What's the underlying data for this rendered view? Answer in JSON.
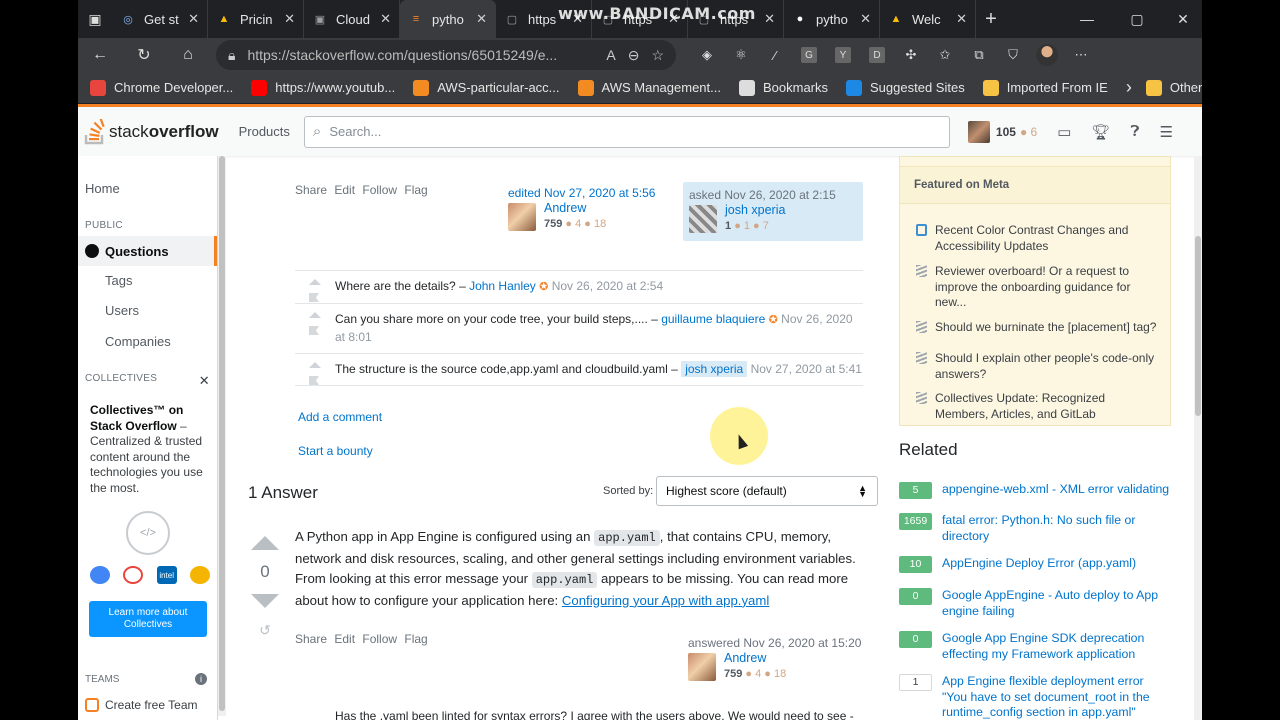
{
  "browser": {
    "tabs": [
      {
        "label": "Get st",
        "fav": "◎",
        "favcolor": "#8ab4f8"
      },
      {
        "label": "Pricin",
        "fav": "▲",
        "favcolor": "#fbbc04"
      },
      {
        "label": "Cloud",
        "fav": "▣",
        "favcolor": "#9aa0a6"
      },
      {
        "label": "pytho",
        "fav": "≡",
        "favcolor": "#f48225",
        "active": true
      },
      {
        "label": "https",
        "fav": "▢",
        "favcolor": "#9aa0a6"
      },
      {
        "label": "https",
        "fav": "▢",
        "favcolor": "#9aa0a6"
      },
      {
        "label": "https",
        "fav": "▢",
        "favcolor": "#9aa0a6"
      },
      {
        "label": "pytho",
        "fav": "●",
        "favcolor": "#ffffff"
      },
      {
        "label": "Welc",
        "fav": "▲",
        "favcolor": "#fbbc04"
      }
    ],
    "tab_close": "✕",
    "new_tab": "+",
    "watermark": "www.BANDICAM.com",
    "url": "https://stackoverflow.com/questions/65015249/e...",
    "ext_letters": [
      "G",
      "Y",
      "D"
    ],
    "bookmarks": [
      {
        "label": "Chrome Developer...",
        "color": "#e8453c"
      },
      {
        "label": "https://www.youtub...",
        "color": "#ff0000"
      },
      {
        "label": "AWS-particular-acc...",
        "color": "#f28b21"
      },
      {
        "label": "AWS Management...",
        "color": "#f28b21"
      },
      {
        "label": "Bookmarks",
        "color": "#dddddd"
      },
      {
        "label": "Suggested Sites",
        "color": "#1e88e5"
      },
      {
        "label": "Imported From IE",
        "color": "#f6c344"
      }
    ],
    "bookmarks_more": "›",
    "other_favorites": "Other favorites"
  },
  "so_header": {
    "logo_light": "stack",
    "logo_bold": "overflow",
    "products": "Products",
    "search_placeholder": "Search...",
    "reputation": "105",
    "bronze": "● 6"
  },
  "leftnav": {
    "home": "Home",
    "public": "PUBLIC",
    "questions": "Questions",
    "tags": "Tags",
    "users": "Users",
    "companies": "Companies",
    "collectives": "COLLECTIVES",
    "collectives_close": "✕",
    "collectives_title": "Collectives™ on Stack Overflow",
    "collectives_desc": " – Centralized & trusted content around the technologies you use the most.",
    "learn_more": "Learn more about Collectives",
    "teams": "TEAMS",
    "create_team": "Create free Team"
  },
  "question": {
    "menu": "Share Edit Follow Flag",
    "edited": "edited Nov 27, 2020 at 5:56",
    "editor": {
      "name": "Andrew",
      "rep": "759",
      "badges": "● 4 ● 18"
    },
    "asked": "asked Nov 26, 2020 at 2:15",
    "asker": {
      "name": "josh xperia",
      "rep": "1",
      "badges": "● 1 ● 7"
    },
    "comments": [
      {
        "text": "Where are the details? – ",
        "user": "John Hanley",
        "mod": "✪",
        "date": "Nov 26, 2020 at 2:54"
      },
      {
        "text": "Can you share more on your code tree, your build steps,.... – ",
        "user": "guillaume blaquiere",
        "mod": "✪",
        "date": "Nov 26, 2020 at 8:01"
      },
      {
        "text": "The structure is the source code,app.yaml and cloudbuild.yaml – ",
        "user": "josh xperia",
        "owner": true,
        "date": "Nov 27, 2020 at 5:41"
      }
    ],
    "add_comment": "Add a comment",
    "start_bounty": "Start a bounty"
  },
  "answers": {
    "heading": "1 Answer",
    "sorted_by": "Sorted by:",
    "sort_value": "Highest score (default)",
    "answer": {
      "score": "0",
      "body_1": "A Python app in App Engine is configured using an ",
      "code_1": "app.yaml",
      "body_2": ", that contains CPU, memory, network and disk resources, scaling, and other general settings including environment variables. From looking at this error message your ",
      "code_2": "app.yaml",
      "body_3": " appears to be missing. You can read more about how to configure your application here: ",
      "link": "Configuring your App with app.yaml",
      "menu": "Share Edit Follow Flag",
      "answered": "answered Nov 26, 2020 at 15:20",
      "author": {
        "name": "Andrew",
        "rep": "759",
        "badges": "● 4 ● 18"
      }
    },
    "next_comment": "Has the .yaml been linted for syntax errors? I agree with the users above. We would need to see -"
  },
  "sidebar": {
    "meta_title": "Featured on Meta",
    "meta_items": [
      "Recent Color Contrast Changes and Accessibility Updates",
      "Reviewer overboard! Or a request to improve the onboarding guidance for new...",
      "Should we burninate the [placement] tag?",
      "Should I explain other people's code-only answers?",
      "Collectives Update: Recognized Members, Articles, and GitLab"
    ],
    "related_title": "Related",
    "related": [
      {
        "score": "5",
        "title": "appengine-web.xml - XML error validating",
        "answered": true
      },
      {
        "score": "1659",
        "title": "fatal error: Python.h: No such file or directory",
        "answered": true
      },
      {
        "score": "10",
        "title": "AppEngine Deploy Error (app.yaml)",
        "answered": true
      },
      {
        "score": "0",
        "title": "Google AppEngine - Auto deploy to App engine failing",
        "answered": true
      },
      {
        "score": "0",
        "title": "Google App Engine SDK deprecation effecting my Framework application",
        "answered": true
      },
      {
        "score": "1",
        "title": "App Engine flexible deployment error \"You have to set document_root in the runtime_config section in app.yaml\"",
        "answered": false
      }
    ]
  }
}
